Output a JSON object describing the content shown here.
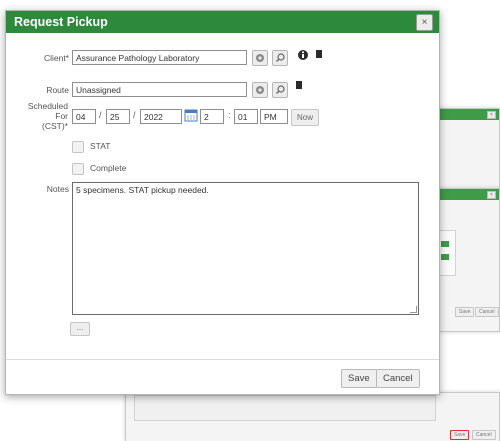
{
  "dialog": {
    "title": "Request Pickup",
    "close_icon": "×",
    "client": {
      "label": "Client*",
      "value": "Assurance Pathology Laboratory"
    },
    "route": {
      "label": "Route",
      "value": "Unassigned"
    },
    "scheduled": {
      "label_line1": "Scheduled",
      "label_line2": "For",
      "label_line3": "(CST)*",
      "month": "04",
      "day": "25",
      "year": "2022",
      "hour": "2",
      "minute": "01",
      "ampm": "PM",
      "date_sep": "/",
      "time_sep": ":",
      "now_label": "Now"
    },
    "checkboxes": [
      {
        "label": "STAT",
        "checked": false
      },
      {
        "label": "Complete",
        "checked": false
      }
    ],
    "notes": {
      "label": "Notes",
      "value": "5 specimens. STAT pickup needed."
    },
    "more_label": "...",
    "save_label": "Save",
    "cancel_label": "Cancel"
  },
  "background": {
    "save_label": "Save",
    "cancel_label": "Cancel"
  },
  "icons": {
    "clear": "clear-icon",
    "search": "search-icon",
    "info": "info-icon",
    "document": "document-icon",
    "calendar": "calendar-icon",
    "close": "close-icon",
    "resize": "resize-grip-icon"
  },
  "colors": {
    "titlebar": "#2d8a3c",
    "background_titlebar": "#3f9b47",
    "highlight": "#e03030"
  }
}
